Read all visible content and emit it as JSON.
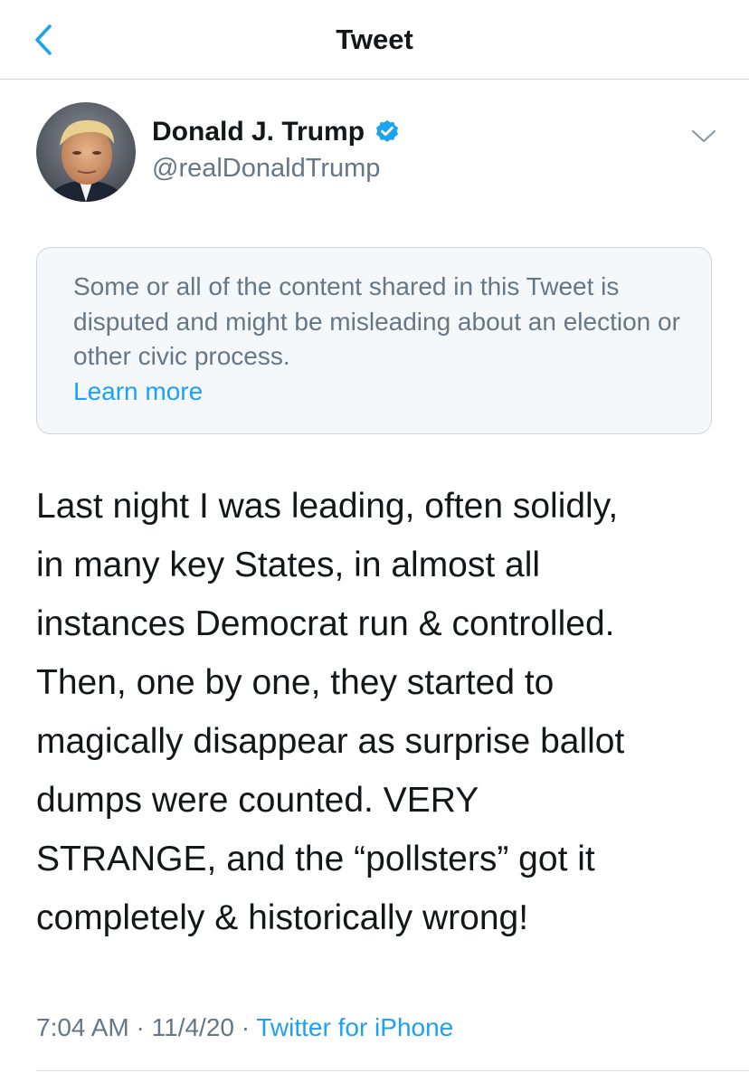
{
  "nav": {
    "title": "Tweet",
    "back_icon": "chevron-left-icon"
  },
  "author": {
    "display_name": "Donald J. Trump",
    "handle": "@realDonaldTrump",
    "verified_icon": "verified-badge-icon",
    "menu_icon": "chevron-down-icon"
  },
  "notice": {
    "text": "Some or all of the content shared in this Tweet is disputed and might be misleading about an election or other civic process.",
    "link": "Learn more"
  },
  "tweet": {
    "text": "Last night I was leading, often solidly,\nin many key States, in almost all\ninstances Democrat run & controlled.\nThen, one by one, they started to\nmagically disappear as surprise ballot\ndumps were counted. VERY\nSTRANGE, and the “pollsters” got it\ncompletely & historically wrong!"
  },
  "meta": {
    "time": "7:04 AM",
    "separator": "·",
    "date": "11/4/20",
    "source": "Twitter for iPhone"
  },
  "colors": {
    "accent": "#1da1f2",
    "text_primary": "#14171a",
    "text_secondary": "#657786",
    "notice_background": "#f5f8fa",
    "notice_border": "#ccd6dd"
  }
}
